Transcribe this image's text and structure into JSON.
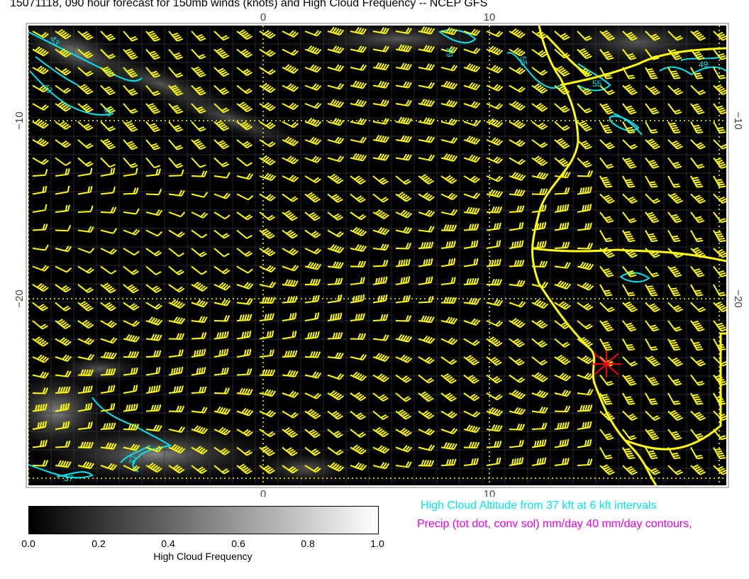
{
  "title": "15071118, 090 hour forecast for 150mb winds (knots) and High Cloud Frequency -- NCEP GFS",
  "map": {
    "lon_ticks": [
      "0",
      "10"
    ],
    "lat_ticks": [
      "−10",
      "−20"
    ],
    "contour_labels": [
      "43",
      "43",
      "43",
      "49",
      "55",
      "55",
      "37",
      "37",
      "49"
    ],
    "colors": {
      "background": "#000000",
      "wind_barbs": "#ffff00",
      "coastline": "#ffff00",
      "cloud_altitude_contours": "#00e5ee",
      "grid_dotted": "#ffff00",
      "station_marker": "#ff0000"
    }
  },
  "legend": {
    "cloud_altitude": "High Cloud Altitude from 37 kft at 6 kft intervals",
    "precip": "Precip (tot dot, conv sol) mm/day 40 mm/day contours,"
  },
  "colorbar": {
    "label": "High Cloud Frequency",
    "ticks": [
      "0.0",
      "0.2",
      "0.4",
      "0.6",
      "0.8",
      "1.0"
    ],
    "range": [
      0.0,
      1.0
    ],
    "colors": [
      "#000000",
      "#ffffff"
    ]
  }
}
